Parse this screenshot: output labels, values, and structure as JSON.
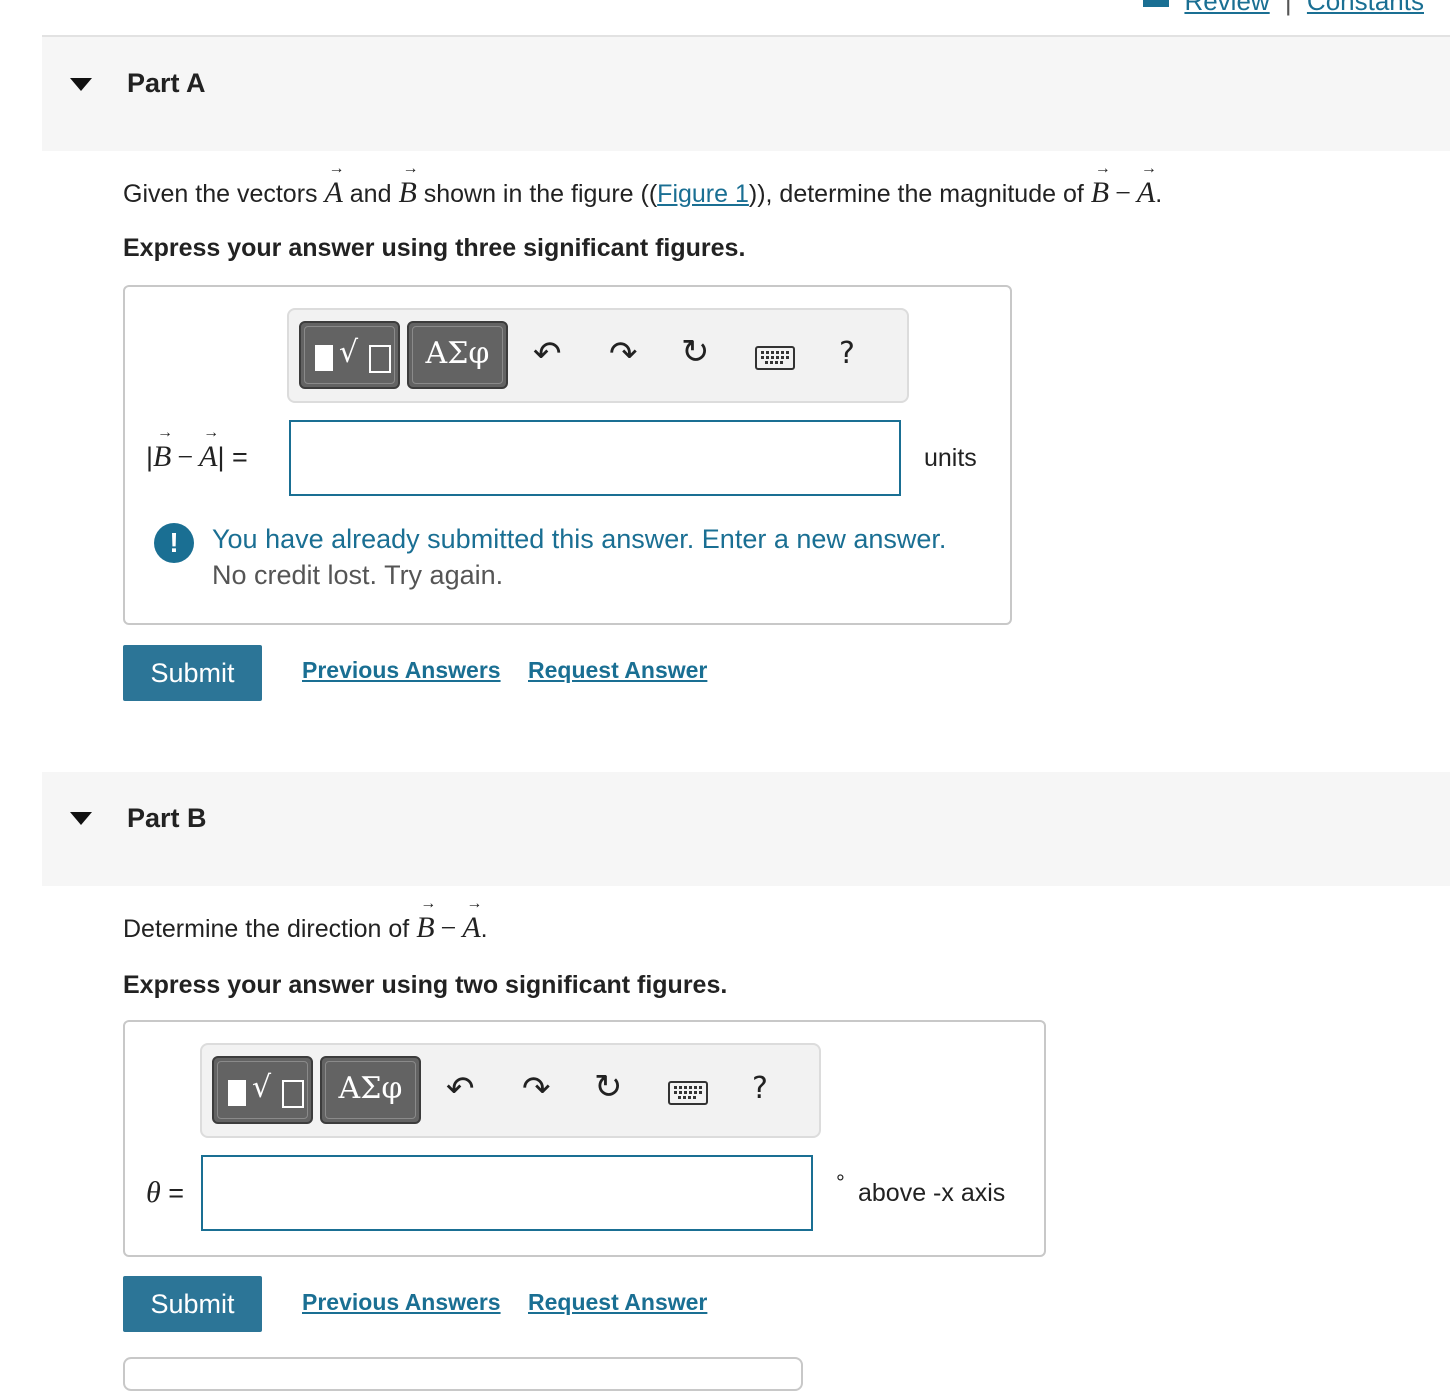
{
  "top_links": {
    "review": "Review",
    "separator": "|",
    "constants": "Constants"
  },
  "part_a": {
    "title": "Part A",
    "question": {
      "given": "Given the vectors",
      "vec_a": "A",
      "and": "and",
      "vec_b": "B",
      "shown": "shown in the figure ((",
      "figure_link": "Figure 1",
      "determine": ")), determine the magnitude of",
      "minus": "−",
      "period": "."
    },
    "instruction": "Express your answer using three significant figures.",
    "toolbar": {
      "greek_label": "ΑΣφ",
      "help": "?"
    },
    "equation_label": {
      "open": "|",
      "b": "B",
      "minus": "−",
      "a": "A",
      "close": "|",
      "equals": " ="
    },
    "input": {
      "value": "",
      "placeholder": ""
    },
    "units": "units",
    "feedback": {
      "icon": "!",
      "message": "You have already submitted this answer. Enter a new answer.",
      "sub": "No credit lost. Try again."
    },
    "submit_label": "Submit",
    "previous_answers": "Previous Answers",
    "request_answer": "Request Answer"
  },
  "part_b": {
    "title": "Part B",
    "question": {
      "text": "Determine the direction of",
      "vec_b": "B",
      "minus": "−",
      "vec_a": "A",
      "period": "."
    },
    "instruction": "Express your answer using two significant figures.",
    "toolbar": {
      "greek_label": "ΑΣφ",
      "help": "?"
    },
    "equation_label": {
      "theta": "θ",
      "equals": " ="
    },
    "input": {
      "value": "",
      "placeholder": ""
    },
    "units": {
      "degree": "°",
      "text": "above -x axis"
    },
    "submit_label": "Submit",
    "previous_answers": "Previous Answers",
    "request_answer": "Request Answer"
  },
  "colors": {
    "accent": "#1a6f93",
    "submit_bg": "#2c7597",
    "header_bg": "#f6f6f6"
  },
  "icons": [
    "book-icon",
    "caret-down-icon",
    "template-icon",
    "greek-icon",
    "undo-icon",
    "redo-icon",
    "reset-icon",
    "keyboard-icon",
    "help-icon",
    "warning-icon"
  ]
}
